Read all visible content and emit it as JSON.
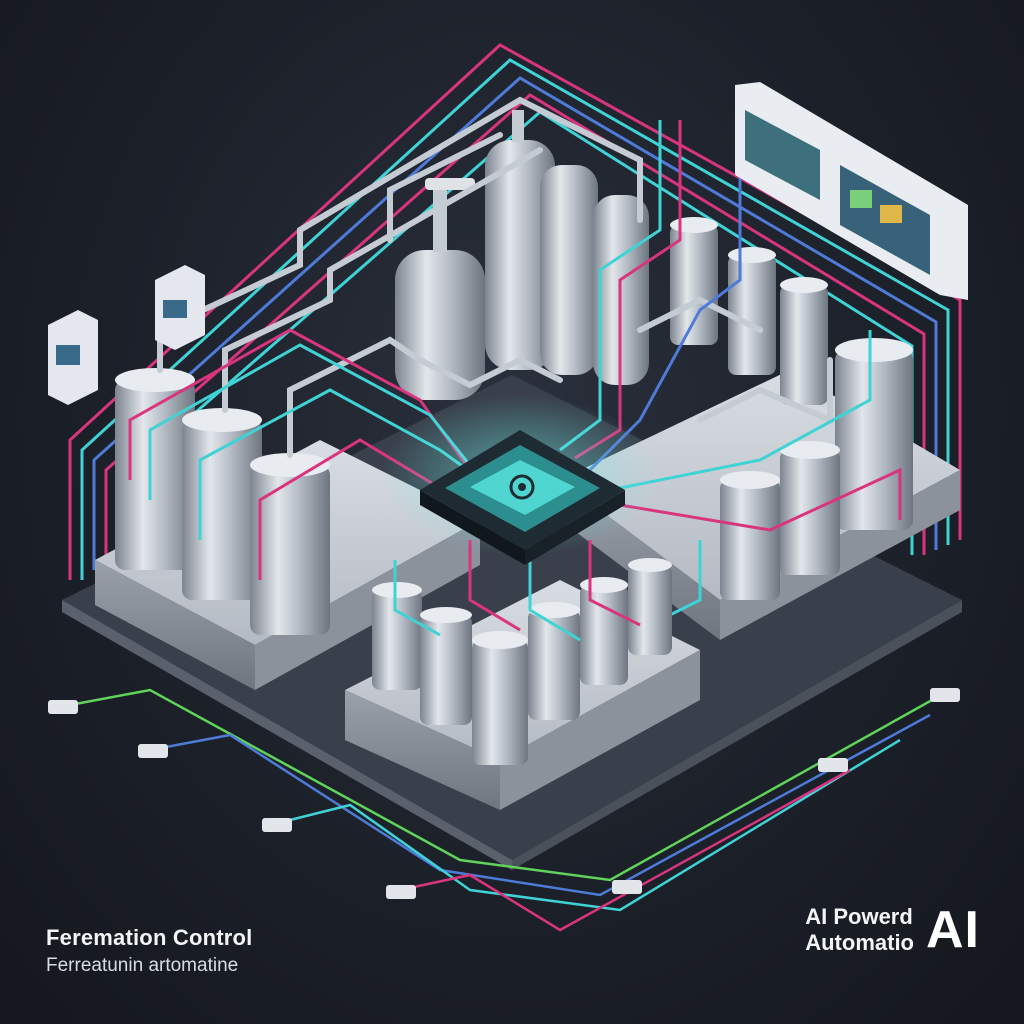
{
  "captions": {
    "left_title": "Feremation Control",
    "left_subtitle": "Ferreatunin artomatine",
    "right_line1": "AI Powerd",
    "right_line2": "Automatio",
    "right_badge": "AI"
  },
  "colors": {
    "background": "#1c2029",
    "steel": "#c5cbd3",
    "cyan_line": "#3fd3d6",
    "magenta_line": "#d9357e",
    "blue_line": "#4f7bd8",
    "green_line": "#5fd35a",
    "chip": "#2c8e8e"
  },
  "icons": {
    "central_chip": "ai-processor-chip-icon",
    "tanks": "fermentation-tank-icon",
    "panels": "control-panel-icon",
    "sensors": "sensor-module-icon"
  }
}
